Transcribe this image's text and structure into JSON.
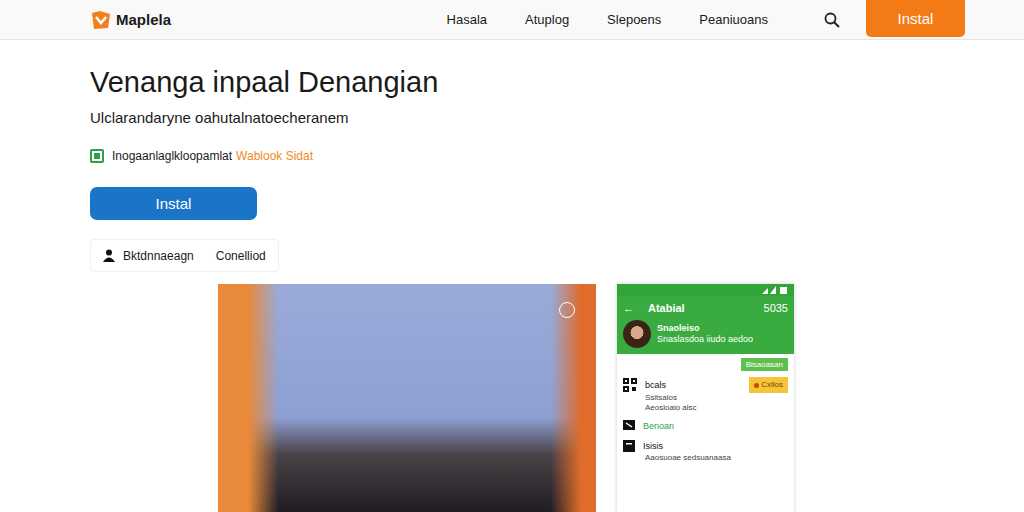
{
  "logo": {
    "name": "Maplela"
  },
  "nav": {
    "links": [
      "Hasala",
      "Atuplog",
      "Slepoens",
      "Peaniuoans"
    ],
    "button": "Instal"
  },
  "hero": {
    "title": "Venanga inpaal Denangian",
    "subtitle": "Ulclarandaryne oahutalnatoecheranem",
    "feature": {
      "text": "Inogaanlaglkloopamlat",
      "highlight": "Wablook Sidat",
      "checked": true
    },
    "button": "Instal",
    "meta": {
      "author": "Bktdnnaeagn",
      "status": "Conelliod"
    }
  },
  "phone": {
    "back": "←",
    "title": "Atabial",
    "status": "5035",
    "profile": {
      "name": "Snaoleiso",
      "subtitle": "Snaslasdoa iiudo aedoo"
    },
    "action": "Bisaoasan",
    "items": [
      {
        "kind": "qr",
        "title": "bcals",
        "details": [
          "Ssitsalos",
          "Aeosloaio alsc"
        ],
        "badge": "Cxllos"
      },
      {
        "kind": "link",
        "title": "Benoan",
        "details": [],
        "badge": ""
      },
      {
        "kind": "plain",
        "title": "Isisis",
        "details": [
          "Aaosuoae sedsuanaasa"
        ],
        "badge": ""
      }
    ]
  }
}
